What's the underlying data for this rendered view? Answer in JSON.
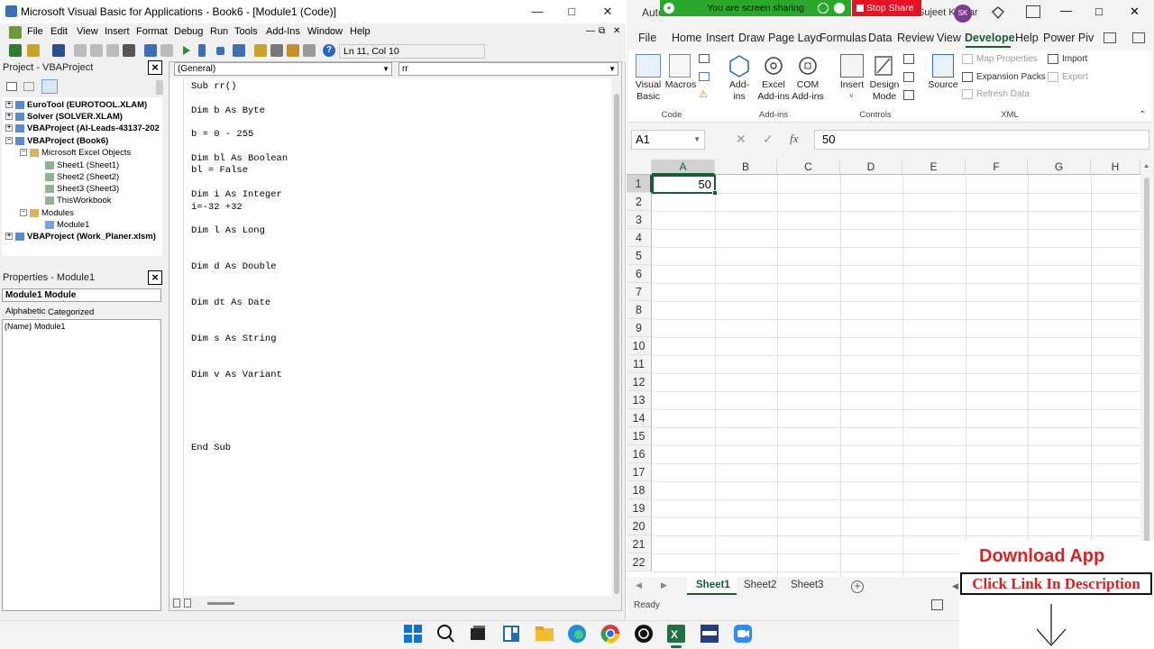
{
  "vba": {
    "title": "Microsoft Visual Basic for Applications - Book6 - [Module1 (Code)]",
    "menu": [
      "File",
      "Edit",
      "View",
      "Insert",
      "Format",
      "Debug",
      "Run",
      "Tools",
      "Add-Ins",
      "Window",
      "Help"
    ],
    "status_pos": "Ln 11, Col 10",
    "project_title": "Project - VBAProject",
    "tree": [
      {
        "label": "EuroTool (EUROTOOL.XLAM)",
        "bold": true
      },
      {
        "label": "Solver (SOLVER.XLAM)",
        "bold": true
      },
      {
        "label": "VBAProject (AI-Leads-43137-202",
        "bold": true
      },
      {
        "label": "VBAProject (Book6)",
        "bold": true
      },
      {
        "label": "Microsoft Excel Objects",
        "bold": false
      },
      {
        "label": "Sheet1 (Sheet1)",
        "bold": false
      },
      {
        "label": "Sheet2 (Sheet2)",
        "bold": false
      },
      {
        "label": "Sheet3 (Sheet3)",
        "bold": false
      },
      {
        "label": "ThisWorkbook",
        "bold": false
      },
      {
        "label": "Modules",
        "bold": false
      },
      {
        "label": "Module1",
        "bold": false
      },
      {
        "label": "VBAProject (Work_Planer.xlsm)",
        "bold": true
      }
    ],
    "properties_title": "Properties - Module1",
    "properties_combo": "Module1 Module",
    "prop_tabs": [
      "Alphabetic",
      "Categorized"
    ],
    "prop_row": {
      "name": "(Name)",
      "value": "Module1"
    },
    "combo_general": "(General)",
    "combo_proc": "rr",
    "code_lines": [
      "Sub rr()",
      "",
      "Dim b As Byte",
      "",
      "b = 0 - 255",
      "",
      "Dim bl As Boolean",
      "bl = False",
      "",
      "Dim i As Integer",
      "i=-32 +32",
      "",
      "Dim l As Long",
      "",
      "",
      "Dim d As Double",
      "",
      "",
      "Dim dt As Date",
      "",
      "",
      "Dim s As String",
      "",
      "",
      "Dim v As Variant",
      "",
      "",
      "",
      "",
      "",
      "End Sub"
    ]
  },
  "excel": {
    "title_left": "Auto",
    "user": "Sujeet Kumar",
    "user_initials": "SK",
    "tabs": [
      "File",
      "Home",
      "Insert",
      "Draw",
      "Page Layc",
      "Formulas",
      "Data",
      "Review",
      "View",
      "Develope",
      "Help",
      "Power Piv"
    ],
    "active_tab": "Develope",
    "ribbon": {
      "visual_basic": "Visual Basic",
      "macros": "Macros",
      "addins": "Add-ins",
      "excel_addins": "Excel Add-ins",
      "com_addins": "COM Add-ins",
      "insert": "Insert",
      "design_mode": "Design Mode",
      "source": "Source",
      "map_properties": "Map Properties",
      "expansion_packs": "Expansion Packs",
      "refresh_data": "Refresh Data",
      "import": "Import",
      "export": "Export",
      "groups": [
        "Code",
        "Add-ins",
        "Controls",
        "XML"
      ]
    },
    "name_box": "A1",
    "formula_value": "50",
    "columns": [
      "A",
      "B",
      "C",
      "D",
      "E",
      "F",
      "G",
      "H"
    ],
    "rows": [
      "1",
      "2",
      "3",
      "4",
      "5",
      "6",
      "7",
      "8",
      "9",
      "10",
      "11",
      "12",
      "13",
      "14",
      "15",
      "16",
      "17",
      "18",
      "19",
      "20",
      "21",
      "22"
    ],
    "cell_a1": "50",
    "sheets": [
      "Sheet1",
      "Sheet2",
      "Sheet3"
    ],
    "active_sheet": "Sheet1",
    "status": "Ready"
  },
  "share": {
    "text": "You are screen sharing",
    "stop": "Stop Share"
  },
  "ad": {
    "title": "Download App",
    "subtitle": "Click Link In Description"
  }
}
